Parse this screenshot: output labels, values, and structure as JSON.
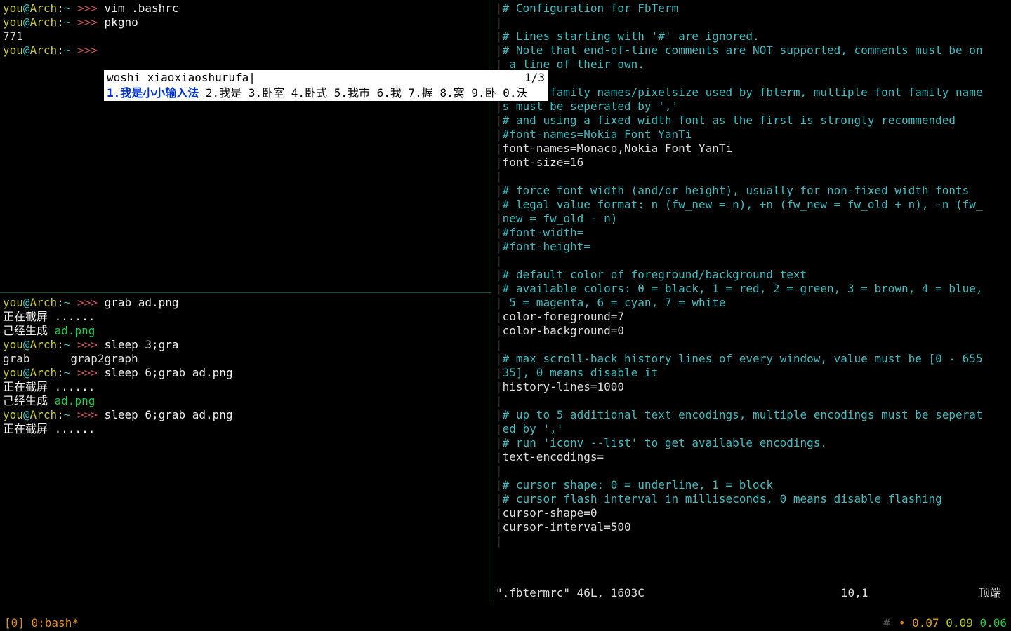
{
  "left_top": {
    "lines": [
      {
        "type": "prompt",
        "user": "you",
        "host": "Arch",
        "path": "~",
        "ps": ">>>",
        "cmd": "vim .bashrc"
      },
      {
        "type": "prompt",
        "user": "you",
        "host": "Arch",
        "path": "~",
        "ps": ">>>",
        "cmd": "pkgno"
      },
      {
        "type": "out",
        "text": "771"
      },
      {
        "type": "prompt",
        "user": "you",
        "host": "Arch",
        "path": "~",
        "ps": ">>>",
        "cmd": ""
      }
    ]
  },
  "ime": {
    "input": "woshi xiaoxiaoshurufa",
    "page": "1/3",
    "candidates": [
      {
        "n": "1",
        "text": "我是小小输入法",
        "selected": true
      },
      {
        "n": "2",
        "text": "我是"
      },
      {
        "n": "3",
        "text": "卧室"
      },
      {
        "n": "4",
        "text": "卧式"
      },
      {
        "n": "5",
        "text": "我市"
      },
      {
        "n": "6",
        "text": "我"
      },
      {
        "n": "7",
        "text": "握"
      },
      {
        "n": "8",
        "text": "窝"
      },
      {
        "n": "9",
        "text": "卧"
      },
      {
        "n": "0",
        "text": "沃"
      }
    ]
  },
  "left_bot": {
    "lines": [
      {
        "type": "prompt",
        "user": "you",
        "host": "Arch",
        "path": "~",
        "ps": ">>>",
        "cmd": "grab ad.png"
      },
      {
        "type": "white",
        "text": "正在截屏 ......"
      },
      {
        "type": "gen",
        "prefix": "己经生成 ",
        "file": "ad.png"
      },
      {
        "type": "prompt",
        "user": "you",
        "host": "Arch",
        "path": "~",
        "ps": ">>>",
        "cmd": "sleep 3;gra"
      },
      {
        "type": "out",
        "text": "grab      grap2graph"
      },
      {
        "type": "prompt",
        "user": "you",
        "host": "Arch",
        "path": "~",
        "ps": ">>>",
        "cmd": "sleep 6;grab ad.png"
      },
      {
        "type": "white",
        "text": "正在截屏 ......"
      },
      {
        "type": "gen",
        "prefix": "己经生成 ",
        "file": "ad.png"
      },
      {
        "type": "prompt",
        "user": "you",
        "host": "Arch",
        "path": "~",
        "ps": ">>>",
        "cmd": "sleep 6;grab ad.png"
      },
      {
        "type": "white",
        "text": "正在截屏 ......"
      }
    ]
  },
  "right": {
    "lines": [
      {
        "c": "comment",
        "t": "# Configuration for FbTerm"
      },
      {
        "c": "blank",
        "t": ""
      },
      {
        "c": "comment",
        "t": "# Lines starting with '#' are ignored."
      },
      {
        "c": "comment",
        "t": "# Note that end-of-line comments are NOT supported, comments must be on"
      },
      {
        "c": "comment",
        "t": " a line of their own."
      },
      {
        "c": "blank",
        "t": ""
      },
      {
        "c": "comment",
        "t": "# font family names/pixelsize used by fbterm, multiple font family name"
      },
      {
        "c": "comment",
        "t": "s must be seperated by ','"
      },
      {
        "c": "comment",
        "t": "# and using a fixed width font as the first is strongly recommended"
      },
      {
        "c": "comment",
        "t": "#font-names=Nokia Font YanTi"
      },
      {
        "c": "cfg",
        "t": "font-names=Monaco,Nokia Font YanTi"
      },
      {
        "c": "cfg",
        "t": "font-size=16"
      },
      {
        "c": "blank",
        "t": ""
      },
      {
        "c": "comment",
        "t": "# force font width (and/or height), usually for non-fixed width fonts"
      },
      {
        "c": "comment",
        "t": "# legal value format: n (fw_new = n), +n (fw_new = fw_old + n), -n (fw_"
      },
      {
        "c": "comment",
        "t": "new = fw_old - n)"
      },
      {
        "c": "comment",
        "t": "#font-width="
      },
      {
        "c": "comment",
        "t": "#font-height="
      },
      {
        "c": "blank",
        "t": ""
      },
      {
        "c": "comment",
        "t": "# default color of foreground/background text"
      },
      {
        "c": "comment",
        "t": "# available colors: 0 = black, 1 = red, 2 = green, 3 = brown, 4 = blue,"
      },
      {
        "c": "comment",
        "t": " 5 = magenta, 6 = cyan, 7 = white"
      },
      {
        "c": "cfg",
        "t": "color-foreground=7"
      },
      {
        "c": "cfg",
        "t": "color-background=0"
      },
      {
        "c": "blank",
        "t": ""
      },
      {
        "c": "comment",
        "t": "# max scroll-back history lines of every window, value must be [0 - 655"
      },
      {
        "c": "comment",
        "t": "35], 0 means disable it"
      },
      {
        "c": "cfg",
        "t": "history-lines=1000"
      },
      {
        "c": "blank",
        "t": ""
      },
      {
        "c": "comment",
        "t": "# up to 5 additional text encodings, multiple encodings must be seperat"
      },
      {
        "c": "comment",
        "t": "ed by ','"
      },
      {
        "c": "comment",
        "t": "# run 'iconv --list' to get available encodings."
      },
      {
        "c": "cfg",
        "t": "text-encodings="
      },
      {
        "c": "blank",
        "t": ""
      },
      {
        "c": "comment",
        "t": "# cursor shape: 0 = underline, 1 = block"
      },
      {
        "c": "comment",
        "t": "# cursor flash interval in milliseconds, 0 means disable flashing"
      },
      {
        "c": "cfg",
        "t": "cursor-shape=0"
      },
      {
        "c": "cfg",
        "t": "cursor-interval=500"
      },
      {
        "c": "blank",
        "t": ""
      }
    ],
    "status": {
      "file": "\".fbtermrc\" 46L, 1603C",
      "pos": "10,1",
      "pct": "顶端"
    }
  },
  "tmux": {
    "left": "[0] 0:bash*",
    "hash": "#",
    "load": [
      "0.07",
      "0.09",
      "0.06"
    ]
  }
}
